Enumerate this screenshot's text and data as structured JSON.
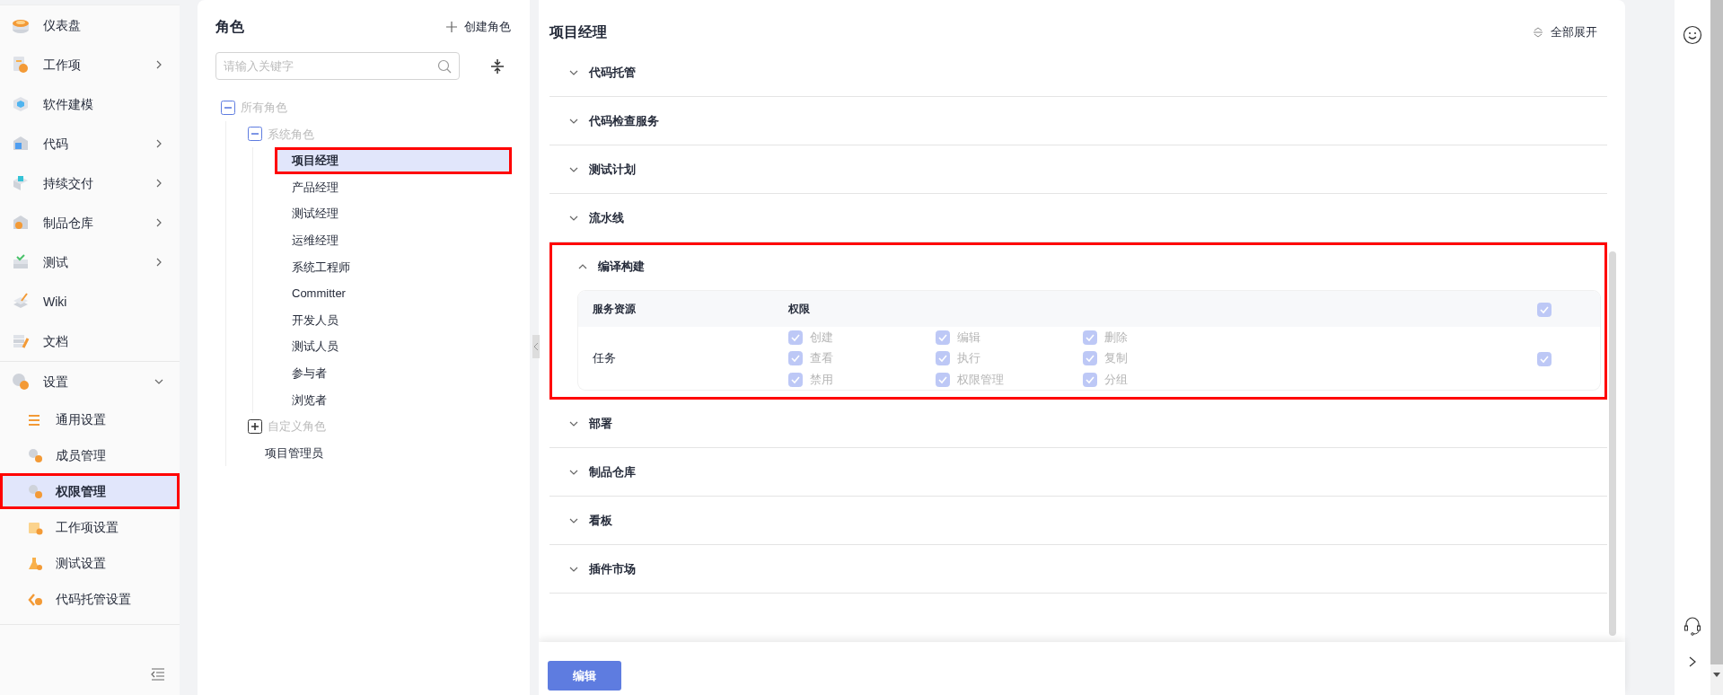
{
  "sidebar": {
    "items": [
      {
        "label": "仪表盘",
        "has_submenu": false
      },
      {
        "label": "工作项",
        "has_submenu": true
      },
      {
        "label": "软件建模",
        "has_submenu": false
      },
      {
        "label": "代码",
        "has_submenu": true
      },
      {
        "label": "持续交付",
        "has_submenu": true
      },
      {
        "label": "制品仓库",
        "has_submenu": true
      },
      {
        "label": "测试",
        "has_submenu": true
      },
      {
        "label": "Wiki",
        "has_submenu": false
      },
      {
        "label": "文档",
        "has_submenu": false
      }
    ],
    "settings": {
      "label": "设置",
      "expanded": true,
      "children": [
        {
          "label": "通用设置",
          "selected": false,
          "highlighted": false
        },
        {
          "label": "成员管理",
          "selected": false,
          "highlighted": false
        },
        {
          "label": "权限管理",
          "selected": true,
          "highlighted": true
        },
        {
          "label": "工作项设置",
          "selected": false,
          "highlighted": false
        },
        {
          "label": "测试设置",
          "selected": false,
          "highlighted": false
        },
        {
          "label": "代码托管设置",
          "selected": false,
          "highlighted": false
        }
      ]
    }
  },
  "roles_panel": {
    "title": "角色",
    "create_button": "创建角色",
    "search": {
      "placeholder": "请输入关键字"
    },
    "tree": [
      {
        "kind": "group",
        "label": "所有角色",
        "expanded": true,
        "children": [
          {
            "kind": "group",
            "label": "系统角色",
            "expanded": true,
            "children": [
              {
                "kind": "role",
                "label": "项目经理",
                "selected": true,
                "highlighted": true
              },
              {
                "kind": "role",
                "label": "产品经理",
                "selected": false,
                "highlighted": false
              },
              {
                "kind": "role",
                "label": "测试经理",
                "selected": false,
                "highlighted": false
              },
              {
                "kind": "role",
                "label": "运维经理",
                "selected": false,
                "highlighted": false
              },
              {
                "kind": "role",
                "label": "系统工程师",
                "selected": false,
                "highlighted": false
              },
              {
                "kind": "role",
                "label": "Committer",
                "selected": false,
                "highlighted": false
              },
              {
                "kind": "role",
                "label": "开发人员",
                "selected": false,
                "highlighted": false
              },
              {
                "kind": "role",
                "label": "测试人员",
                "selected": false,
                "highlighted": false
              },
              {
                "kind": "role",
                "label": "参与者",
                "selected": false,
                "highlighted": false
              },
              {
                "kind": "role",
                "label": "浏览者",
                "selected": false,
                "highlighted": false
              }
            ]
          },
          {
            "kind": "group",
            "label": "自定义角色",
            "expanded": false
          },
          {
            "kind": "role",
            "label": "项目管理员",
            "selected": false,
            "highlighted": false
          }
        ]
      }
    ]
  },
  "detail": {
    "title": "项目经理",
    "expand_all": "全部展开",
    "sections": [
      {
        "title": "代码托管",
        "expanded": false,
        "highlighted": false
      },
      {
        "title": "代码检查服务",
        "expanded": false,
        "highlighted": false
      },
      {
        "title": "测试计划",
        "expanded": false,
        "highlighted": false
      },
      {
        "title": "流水线",
        "expanded": false,
        "highlighted": false
      },
      {
        "title": "编译构建",
        "expanded": true,
        "highlighted": true,
        "table": {
          "columns": [
            "服务资源",
            "权限"
          ],
          "header_check": {
            "checked": true,
            "disabled": true
          },
          "rows": [
            {
              "resource": "任务",
              "all_check": {
                "checked": true,
                "disabled": true
              },
              "permissions": [
                {
                  "label": "创建",
                  "checked": true,
                  "disabled": true
                },
                {
                  "label": "编辑",
                  "checked": true,
                  "disabled": true
                },
                {
                  "label": "删除",
                  "checked": true,
                  "disabled": true
                },
                {
                  "label": "查看",
                  "checked": true,
                  "disabled": true
                },
                {
                  "label": "执行",
                  "checked": true,
                  "disabled": true
                },
                {
                  "label": "复制",
                  "checked": true,
                  "disabled": true
                },
                {
                  "label": "禁用",
                  "checked": true,
                  "disabled": true
                },
                {
                  "label": "权限管理",
                  "checked": true,
                  "disabled": true
                },
                {
                  "label": "分组",
                  "checked": true,
                  "disabled": true
                }
              ]
            }
          ]
        }
      },
      {
        "title": "部署",
        "expanded": false,
        "highlighted": false
      },
      {
        "title": "制品仓库",
        "expanded": false,
        "highlighted": false
      },
      {
        "title": "看板",
        "expanded": false,
        "highlighted": false
      },
      {
        "title": "插件市场",
        "expanded": false,
        "highlighted": false
      }
    ]
  },
  "footer": {
    "edit_button": "编辑"
  }
}
